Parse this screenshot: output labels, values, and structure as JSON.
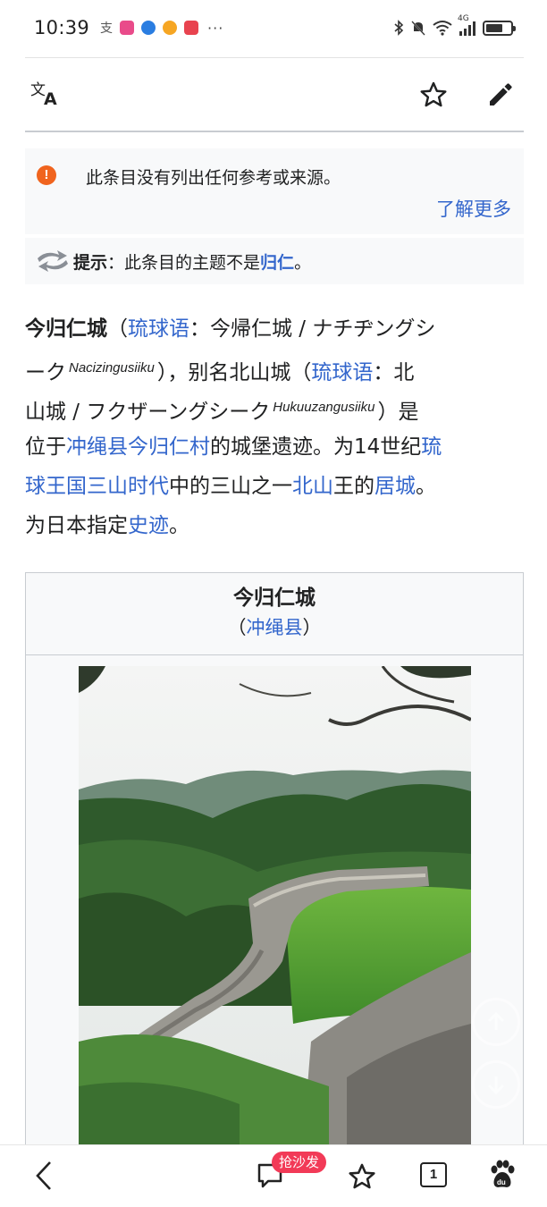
{
  "status_bar": {
    "time": "10:39",
    "dots": "···",
    "network": "4G"
  },
  "toolbar": {
    "icons": [
      "translate-icon",
      "star-icon",
      "edit-icon"
    ]
  },
  "notice": {
    "message": "此条目没有列出任何参考或来源。",
    "learn_more": "了解更多"
  },
  "hint": {
    "label": "提示",
    "colon": "：",
    "text": "此条目的主题不是",
    "link": "归仁",
    "end": "。"
  },
  "article": {
    "title_bold": "今归仁城",
    "p1": "（",
    "link_ryukyuan_1": "琉球语",
    "p2": "：今帰仁城 / ナチヂングシ",
    "p3": "ーク",
    "roman1": "Nacizingusiiku",
    "p4": "），别名北山城（",
    "link_ryukyuan_2": "琉球语",
    "p5": "：北",
    "p6": "山城 / フクザーングシーク",
    "roman2": "Hukuuzangusiiku",
    "p7": "）是",
    "p8": "位于",
    "link_okinawa": "冲绳县",
    "link_nakijin": "今归仁村",
    "p9": "的城堡遗迹。为14世纪",
    "link_kingdom_1": "琉",
    "link_kingdom_2": "球王国",
    "link_sanzan": "三山时代",
    "p10": "中的三山之一",
    "link_hokuzan": "北山",
    "p11": "王的",
    "link_residence": "居城",
    "p12": "。",
    "p13": "为日本指定",
    "link_historic": "史迹",
    "p14": "。"
  },
  "infobox": {
    "title": "今归仁城",
    "sub_open": "（",
    "sub_link": "冲绳县",
    "sub_close": "）"
  },
  "bottom_nav": {
    "badge": "抢沙发",
    "tab_count": "1"
  },
  "colors": {
    "link": "#3366cc",
    "warning": "#f0641e",
    "badge": "#f23a57"
  }
}
